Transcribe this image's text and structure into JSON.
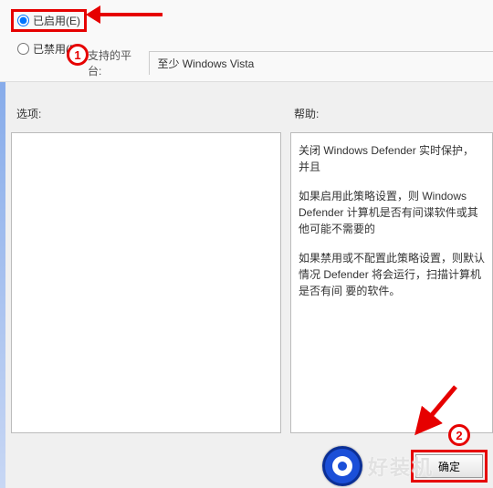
{
  "radios": {
    "enabled_label": "已启用(E)",
    "disabled_label": "已禁用(D)"
  },
  "platform": {
    "label": "支持的平台:",
    "value": "至少 Windows Vista"
  },
  "labels": {
    "options": "选项:",
    "help": "帮助:"
  },
  "help_paragraphs": [
    "关闭 Windows Defender 实时保护，并且",
    "如果启用此策略设置，则 Windows Defender 计算机是否有间谍软件或其他可能不需要的",
    "如果禁用或不配置此策略设置，则默认情况 Defender 将会运行，扫描计算机是否有间 要的软件。"
  ],
  "buttons": {
    "ok": "确定"
  },
  "annotations": {
    "num1": "1",
    "num2": "2"
  },
  "watermark": {
    "text": "好装机"
  }
}
